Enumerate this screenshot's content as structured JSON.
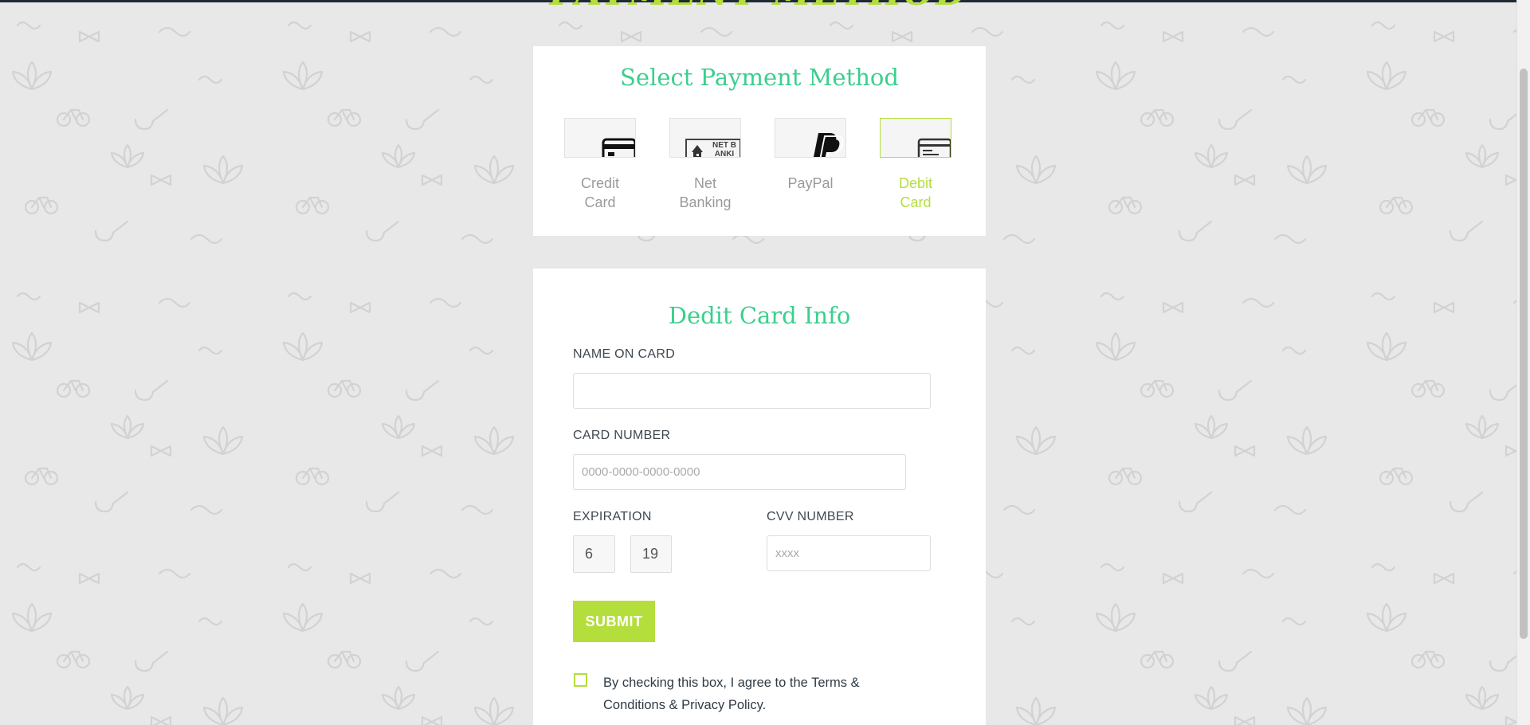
{
  "page": {
    "heading": "PAYMENT METHOD"
  },
  "colors": {
    "accent_green": "#b4de3c",
    "title_teal": "#3bcf8d",
    "background": "#e8e8e8"
  },
  "payment_methods": {
    "title": "Select Payment Method",
    "items": [
      {
        "label_line1": "Credit",
        "label_line2": "Card",
        "icon": "credit-card-icon",
        "selected": false
      },
      {
        "label_line1": "Net",
        "label_line2": "Banking",
        "icon": "net-banking-icon",
        "icon_text": "NET BANKI",
        "selected": false
      },
      {
        "label_line1": "PayPal",
        "label_line2": "",
        "icon": "paypal-icon",
        "selected": false
      },
      {
        "label_line1": "Debit",
        "label_line2": "Card",
        "icon": "debit-card-icon",
        "selected": true
      }
    ]
  },
  "card_info": {
    "title": "Dedit Card Info",
    "name_label": "NAME ON CARD",
    "name_value": "",
    "number_label": "CARD NUMBER",
    "number_placeholder": "0000-0000-0000-0000",
    "expiration_label": "EXPIRATION",
    "exp_month": "6",
    "exp_year": "19",
    "cvv_label": "CVV NUMBER",
    "cvv_placeholder": "xxxx",
    "submit_label": "SUBMIT",
    "terms_text": "By checking this box, I agree to the Terms & Conditions & Privacy Policy.",
    "terms_checked": false
  }
}
